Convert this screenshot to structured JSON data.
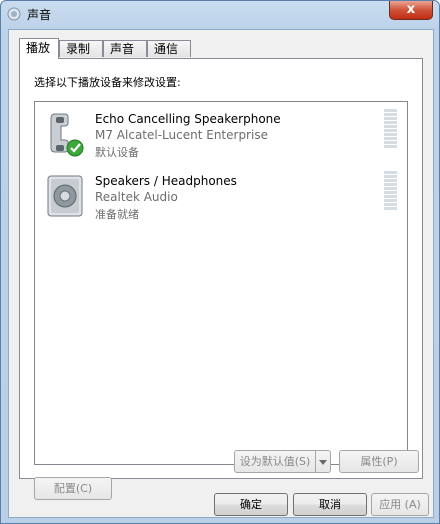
{
  "window": {
    "title": "声音",
    "close_label": "x"
  },
  "tabs": [
    {
      "label": "播放",
      "active": true
    },
    {
      "label": "录制",
      "active": false
    },
    {
      "label": "声音",
      "active": false
    },
    {
      "label": "通信",
      "active": false
    }
  ],
  "instruction": "选择以下播放设备来修改设置:",
  "devices": [
    {
      "name": "Echo Cancelling Speakerphone",
      "model": "M7 Alcatel-Lucent Enterprise",
      "status": "默认设备",
      "icon": "telephone-handset-icon",
      "badge": "default-check-icon"
    },
    {
      "name": "Speakers / Headphones",
      "model": "Realtek Audio",
      "status": "准备就绪",
      "icon": "speaker-icon"
    }
  ],
  "buttons": {
    "configure": "配置(C)",
    "set_default": "设为默认值(S)",
    "properties": "属性(P)",
    "ok": "确定",
    "cancel": "取消",
    "apply": "应用 (A)"
  }
}
